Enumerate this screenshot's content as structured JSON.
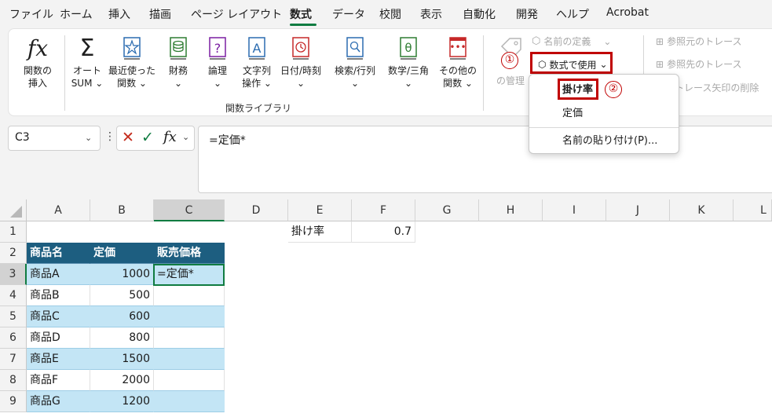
{
  "tabs": [
    "ファイル",
    "ホーム",
    "挿入",
    "描画",
    "ページ レイアウト",
    "数式",
    "データ",
    "校閲",
    "表示",
    "自動化",
    "開発",
    "ヘルプ",
    "Acrobat"
  ],
  "ribbon": {
    "insert_function": [
      "関数の",
      "挿入"
    ],
    "autosum": [
      "オート",
      "SUM ⌄"
    ],
    "recent": [
      "最近使った",
      "関数 ⌄"
    ],
    "financial": [
      "財務",
      "⌄"
    ],
    "logical": [
      "論理",
      "⌄"
    ],
    "text": [
      "文字列",
      "操作 ⌄"
    ],
    "datetime": [
      "日付/時刻",
      "⌄"
    ],
    "lookup": [
      "検索/行列",
      "⌄"
    ],
    "math": [
      "数学/三角",
      "⌄"
    ],
    "other": [
      "その他の",
      "関数 ⌄"
    ],
    "group_label": "関数ライブラリ",
    "name_manager": "の管理",
    "define_name": "名前の定義",
    "use_in_formula": "数式で使用",
    "trace_precedents": "参照元のトレース",
    "trace_dependents": "参照先のトレース",
    "remove_arrows": "トレース矢印の削除"
  },
  "dropdown": {
    "items": [
      "掛け率",
      "定価",
      "名前の貼り付け(P)..."
    ]
  },
  "markers": [
    "①",
    "②"
  ],
  "formula_bar": {
    "name_box": "C3",
    "formula": "=定価*"
  },
  "grid": {
    "columns": [
      "A",
      "B",
      "C",
      "D",
      "E",
      "F",
      "G",
      "H",
      "I",
      "J",
      "K",
      "L"
    ],
    "rows": [
      "1",
      "2",
      "3",
      "4",
      "5",
      "6",
      "7",
      "8",
      "9"
    ],
    "e1": "掛け率",
    "f1": "0.7",
    "table_headers": [
      "商品名",
      "定価",
      "販売価格"
    ],
    "table_rows": [
      {
        "name": "商品A",
        "price": "1000",
        "sale": "=定価*"
      },
      {
        "name": "商品B",
        "price": "500",
        "sale": ""
      },
      {
        "name": "商品C",
        "price": "600",
        "sale": ""
      },
      {
        "name": "商品D",
        "price": "800",
        "sale": ""
      },
      {
        "name": "商品E",
        "price": "1500",
        "sale": ""
      },
      {
        "name": "商品F",
        "price": "2000",
        "sale": ""
      },
      {
        "name": "商品G",
        "price": "1200",
        "sale": ""
      }
    ]
  },
  "colors": {
    "accent": "#107c41",
    "table_header": "#1d5e80",
    "band": "#c3e5f5",
    "highlight": "#c00000"
  }
}
